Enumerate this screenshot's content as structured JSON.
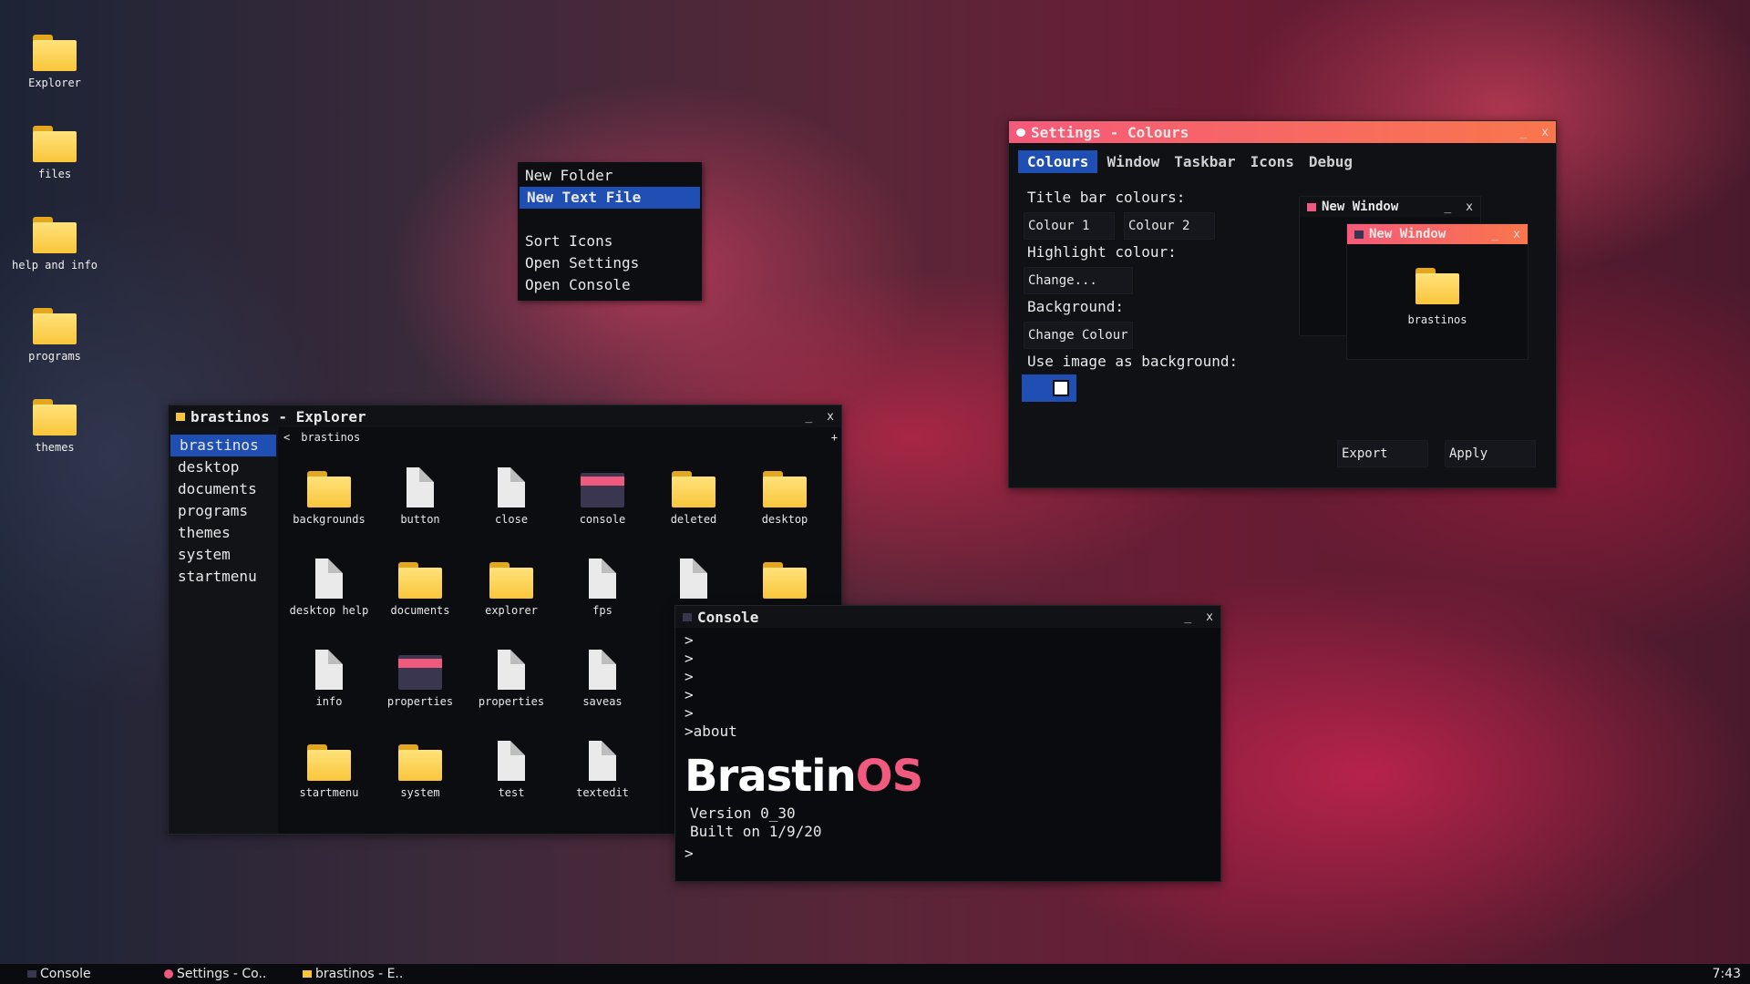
{
  "desktop": {
    "icons": [
      "Explorer",
      "files",
      "help and info",
      "programs",
      "themes"
    ]
  },
  "context_menu": {
    "items": [
      "New Folder",
      "New Text File",
      "",
      "Sort Icons",
      "Open Settings",
      "Open Console"
    ],
    "selected_index": 1
  },
  "explorer": {
    "title": "brastinos - Explorer",
    "path": "brastinos",
    "back": "<",
    "add": "+",
    "min": "_",
    "close": "x",
    "sidebar": [
      "brastinos",
      "desktop",
      "documents",
      "programs",
      "themes",
      "system",
      "startmenu"
    ],
    "files": [
      {
        "name": "backgrounds",
        "type": "folder"
      },
      {
        "name": "button",
        "type": "doc"
      },
      {
        "name": "close",
        "type": "doc"
      },
      {
        "name": "console",
        "type": "console"
      },
      {
        "name": "deleted",
        "type": "folder"
      },
      {
        "name": "desktop",
        "type": "folder"
      },
      {
        "name": "desktop help",
        "type": "doc"
      },
      {
        "name": "documents",
        "type": "folder"
      },
      {
        "name": "explorer",
        "type": "folder"
      },
      {
        "name": "fps",
        "type": "doc"
      },
      {
        "name": "",
        "type": "doc"
      },
      {
        "name": "",
        "type": "folder"
      },
      {
        "name": "info",
        "type": "doc"
      },
      {
        "name": "properties",
        "type": "console"
      },
      {
        "name": "properties",
        "type": "doc"
      },
      {
        "name": "saveas",
        "type": "doc"
      },
      {
        "name": "",
        "type": "none"
      },
      {
        "name": "",
        "type": "none"
      },
      {
        "name": "startmenu",
        "type": "folder"
      },
      {
        "name": "system",
        "type": "folder"
      },
      {
        "name": "test",
        "type": "doc"
      },
      {
        "name": "textedit",
        "type": "doc"
      },
      {
        "name": "",
        "type": "none"
      },
      {
        "name": "",
        "type": "none"
      }
    ]
  },
  "settings": {
    "title": "Settings - Colours",
    "tabs": [
      "Colours",
      "Window",
      "Taskbar",
      "Icons",
      "Debug"
    ],
    "active_tab": 0,
    "title_bar_label": "Title bar colours:",
    "colour1": "Colour 1",
    "colour2": "Colour 2",
    "highlight_label": "Highlight colour:",
    "change": "Change...",
    "background_label": "Background:",
    "change_colour": "Change Colour",
    "image_label": "Use image as background:",
    "export": "Export",
    "apply": "Apply",
    "min": "_",
    "close": "x"
  },
  "preview": {
    "back_title": "New Window",
    "front_title": "New Window",
    "folder_label": "brastinos",
    "min": "_",
    "close": "x"
  },
  "console": {
    "title": "Console",
    "lines": [
      ">",
      ">",
      ">",
      ">",
      ">",
      ">about"
    ],
    "logo_a": "Brastin",
    "logo_b": "OS",
    "version": "Version 0_30",
    "built": "Built on 1/9/20",
    "prompt": ">",
    "min": "_",
    "close": "x"
  },
  "taskbar": {
    "items": [
      "Console",
      "Settings - Co..",
      "brastinos - E.."
    ],
    "clock": "7:43"
  },
  "colors": {
    "accent": "#1f4fb3",
    "title_gradient_start": "#f55a7a",
    "title_gradient_end": "#f9764c",
    "logo_os": "#f05a7e"
  }
}
